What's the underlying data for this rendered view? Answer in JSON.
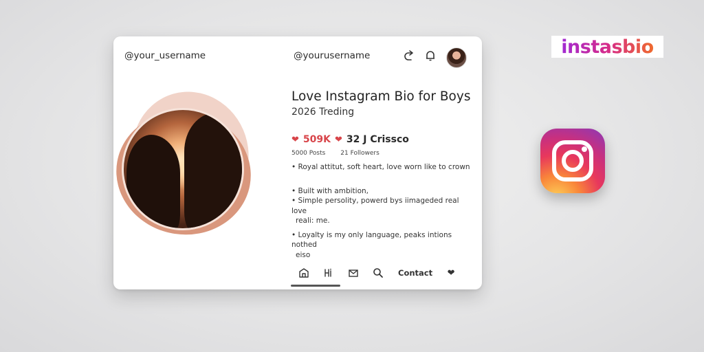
{
  "card": {
    "handle_left": "@your_username",
    "handle_center": "@yourusername",
    "title": "Love Instagram Bio for Boys",
    "subtitle": "2026 Treding",
    "stats": {
      "likes": "509K",
      "second": "32 J Crissco"
    },
    "counts": {
      "posts": "5000 Posts",
      "followers": "21 Followers"
    },
    "bio": [
      "• Royal attitut, soft heart, love worn like to crown",
      "• Built with ambition,",
      "• Simple persolity, powerd bys iimageded real love",
      "  reali: me.",
      "• Loyalty is my only language, peaks intions nothed",
      "  eiso"
    ],
    "nav": {
      "contact": "Contact"
    },
    "icons": [
      "share-icon",
      "bell-icon",
      "avatar",
      "shop-icon",
      "hi-icon",
      "mail-icon",
      "search-icon",
      "heart-icon"
    ]
  },
  "brand": {
    "logo_text": "instasbio"
  },
  "colors": {
    "heart": "#d8454a",
    "photo_accent": "#d9977d",
    "brand_gradient": [
      "#a12ad3",
      "#d62b8a",
      "#ef6a2c"
    ]
  }
}
